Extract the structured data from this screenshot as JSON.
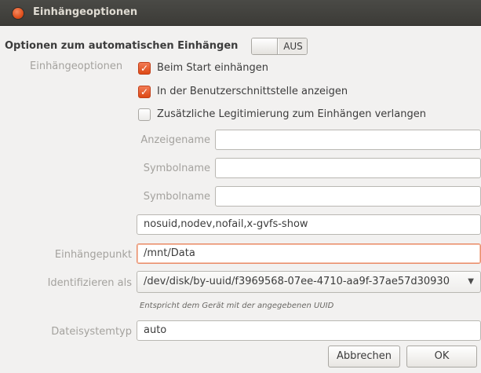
{
  "window": {
    "title": "Einhängeoptionen"
  },
  "heading": "Optionen zum automatischen Einhängen",
  "auto_switch": {
    "state_label": "AUS",
    "on": false
  },
  "mount_options": {
    "label": "Einhängeoptionen",
    "checks": [
      {
        "label": "Beim Start einhängen",
        "checked": true
      },
      {
        "label": "In der Benutzerschnittstelle anzeigen",
        "checked": true
      },
      {
        "label": "Zusätzliche Legitimierung zum Einhängen verlangen",
        "checked": false
      }
    ],
    "fields": [
      {
        "label": "Anzeigename",
        "value": ""
      },
      {
        "label": "Symbolname",
        "value": ""
      },
      {
        "label": "Symbolname",
        "value": ""
      }
    ],
    "options_value": "nosuid,nodev,nofail,x-gvfs-show"
  },
  "mount_point": {
    "label": "Einhängepunkt",
    "value": "/mnt/Data"
  },
  "identify": {
    "label": "Identifizieren als",
    "value": "/dev/disk/by-uuid/f3969568-07ee-4710-aa9f-37ae57d30930",
    "hint": "Entspricht dem Gerät mit der angegebenen UUID"
  },
  "fs_type": {
    "label": "Dateisystemtyp",
    "value": "auto"
  },
  "buttons": {
    "cancel": "Abbrechen",
    "ok": "OK"
  },
  "colors": {
    "accent": "#dd4814",
    "titlebar": "#3c3b37",
    "background": "#f2f1f0"
  }
}
